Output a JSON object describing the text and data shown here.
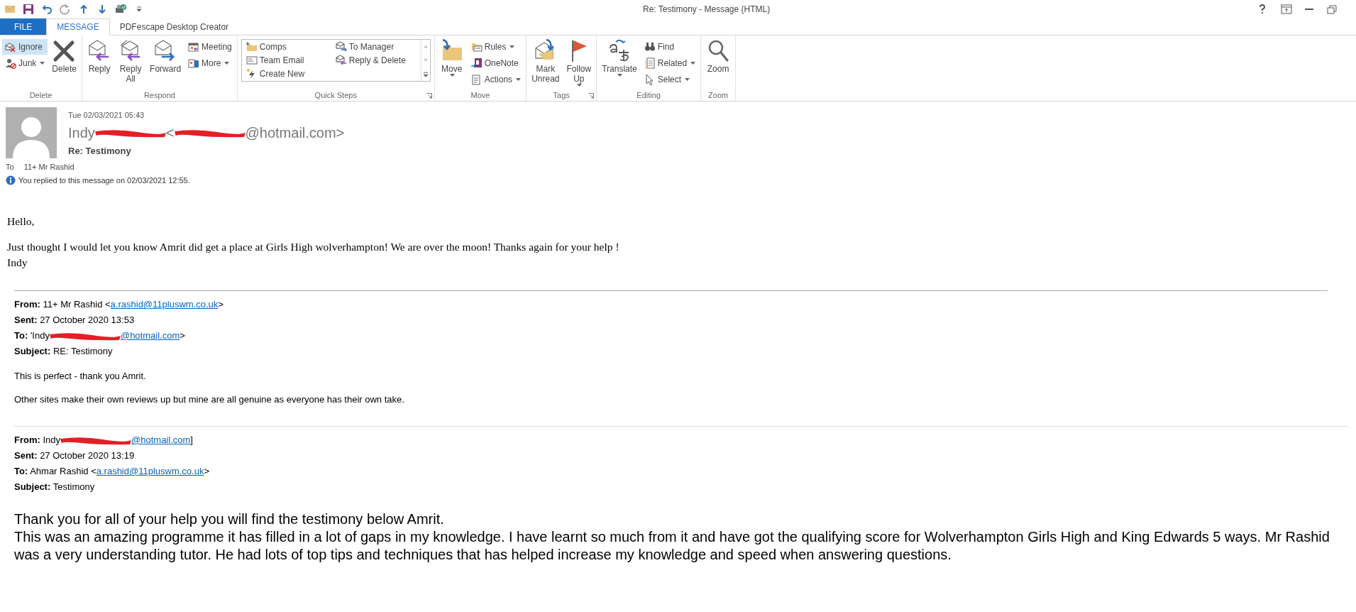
{
  "window": {
    "title": "Re: Testimony - Message (HTML)"
  },
  "tabs": [
    {
      "label": "FILE",
      "kind": "file",
      "selected": false
    },
    {
      "label": "MESSAGE",
      "kind": "tab",
      "selected": true
    },
    {
      "label": "PDFescape Desktop Creator",
      "kind": "tab",
      "selected": false
    }
  ],
  "ribbon": [
    {
      "label": "Delete",
      "launcher": false,
      "items": [
        {
          "kind": "stack",
          "buttons": [
            {
              "label": "Ignore",
              "highlighted": true,
              "dropdown": false
            },
            {
              "label": "Junk",
              "highlighted": false,
              "dropdown": true
            }
          ]
        },
        {
          "kind": "large",
          "lines": [
            "Delete"
          ],
          "dropdown": false
        }
      ]
    },
    {
      "label": "Respond",
      "launcher": false,
      "items": [
        {
          "kind": "large",
          "lines": [
            "Reply"
          ],
          "dropdown": false
        },
        {
          "kind": "large",
          "lines": [
            "Reply",
            "All"
          ],
          "dropdown": false
        },
        {
          "kind": "large",
          "lines": [
            "Forward"
          ],
          "dropdown": false
        },
        {
          "kind": "stack",
          "buttons": [
            {
              "label": "Meeting",
              "highlighted": false,
              "dropdown": false
            },
            {
              "label": "More",
              "highlighted": false,
              "dropdown": true
            }
          ]
        }
      ]
    },
    {
      "label": "Quick Steps",
      "launcher": true,
      "items": [
        {
          "kind": "gallery",
          "columns": [
            [
              "Comps",
              "Team Email",
              "Create New"
            ],
            [
              "To Manager",
              "Reply & Delete"
            ]
          ]
        }
      ]
    },
    {
      "label": "Move",
      "launcher": false,
      "items": [
        {
          "kind": "large",
          "lines": [
            "Move"
          ],
          "dropdown": true
        },
        {
          "kind": "stack",
          "buttons": [
            {
              "label": "Rules",
              "highlighted": false,
              "dropdown": true
            },
            {
              "label": "OneNote",
              "highlighted": false,
              "dropdown": false
            },
            {
              "label": "Actions",
              "highlighted": false,
              "dropdown": true
            }
          ]
        }
      ]
    },
    {
      "label": "Tags",
      "launcher": true,
      "items": [
        {
          "kind": "large",
          "lines": [
            "Mark",
            "Unread"
          ],
          "dropdown": false
        },
        {
          "kind": "large",
          "lines": [
            "Follow",
            "Up"
          ],
          "dropdown": true
        }
      ]
    },
    {
      "label": "Editing",
      "launcher": false,
      "items": [
        {
          "kind": "large",
          "lines": [
            "Translate"
          ],
          "dropdown": true
        },
        {
          "kind": "stack",
          "buttons": [
            {
              "label": "Find",
              "highlighted": false,
              "dropdown": false
            },
            {
              "label": "Related",
              "highlighted": false,
              "dropdown": true
            },
            {
              "label": "Select",
              "highlighted": false,
              "dropdown": true
            }
          ]
        }
      ]
    },
    {
      "label": "Zoom",
      "launcher": false,
      "items": [
        {
          "kind": "large",
          "lines": [
            "Zoom"
          ],
          "dropdown": false
        }
      ]
    }
  ],
  "header": {
    "date": "Tue 02/03/2021 05:43",
    "sender": [
      {
        "kind": "text",
        "text": "Indy"
      },
      {
        "kind": "redaction"
      },
      {
        "kind": "text",
        "text": "<"
      },
      {
        "kind": "redaction"
      },
      {
        "kind": "text",
        "text": "@hotmail.com>"
      }
    ],
    "subject": "Re: Testimony",
    "to_label": "To",
    "to": "11+ Mr Rashid",
    "info": "You replied to this message on 02/03/2021 12:55."
  },
  "body": [
    "Hello,",
    "Just thought I would let you know Amrit did get a place at Girls High wolverhampton! We are over the moon! Thanks again for your help !",
    "Indy"
  ],
  "quoted": [
    {
      "headers": [
        {
          "label": "From:",
          "parts": [
            {
              "kind": "text",
              "text": "11+ Mr Rashid <"
            },
            {
              "kind": "link",
              "text": "a.rashid@11pluswm.co.uk"
            },
            {
              "kind": "text",
              "text": ">"
            }
          ]
        },
        {
          "label": "Sent:",
          "parts": [
            {
              "kind": "text",
              "text": "27 October 2020 13:53"
            }
          ]
        },
        {
          "label": "To:",
          "parts": [
            {
              "kind": "text",
              "text": "'Indy"
            },
            {
              "kind": "redaction"
            },
            {
              "kind": "link",
              "text": "@hotmail.com"
            },
            {
              "kind": "text",
              "text": ">"
            }
          ]
        },
        {
          "label": "Subject:",
          "parts": [
            {
              "kind": "text",
              "text": "RE: Testimony"
            }
          ]
        }
      ],
      "paragraphs": [
        "This is perfect - thank you Amrit.",
        "Other sites make their own reviews up but mine are all genuine as everyone has their own take."
      ],
      "large": false
    },
    {
      "headers": [
        {
          "label": "From:",
          "parts": [
            {
              "kind": "text",
              "text": "Indy"
            },
            {
              "kind": "redaction"
            },
            {
              "kind": "link",
              "text": "@hotmail.com"
            },
            {
              "kind": "text",
              "text": "]"
            }
          ]
        },
        {
          "label": "Sent:",
          "parts": [
            {
              "kind": "text",
              "text": "27 October 2020 13:19"
            }
          ]
        },
        {
          "label": "To:",
          "parts": [
            {
              "kind": "text",
              "text": "Ahmar Rashid <"
            },
            {
              "kind": "link",
              "text": "a.rashid@11pluswm.co.uk"
            },
            {
              "kind": "text",
              "text": ">"
            }
          ]
        },
        {
          "label": "Subject:",
          "parts": [
            {
              "kind": "text",
              "text": "Testimony"
            }
          ]
        }
      ],
      "paragraphs": [
        "Thank you for all of your help you will find the testimony below Amrit.",
        "This was an amazing programme it has filled in a lot of gaps in my knowledge. I have learnt so much from it and have got the qualifying score for Wolverhampton Girls High and King Edwards 5 ways. Mr Rashid was a very understanding tutor. He had lots of top tips and techniques that has helped increase my knowledge and speed when answering questions."
      ],
      "large": true
    }
  ]
}
